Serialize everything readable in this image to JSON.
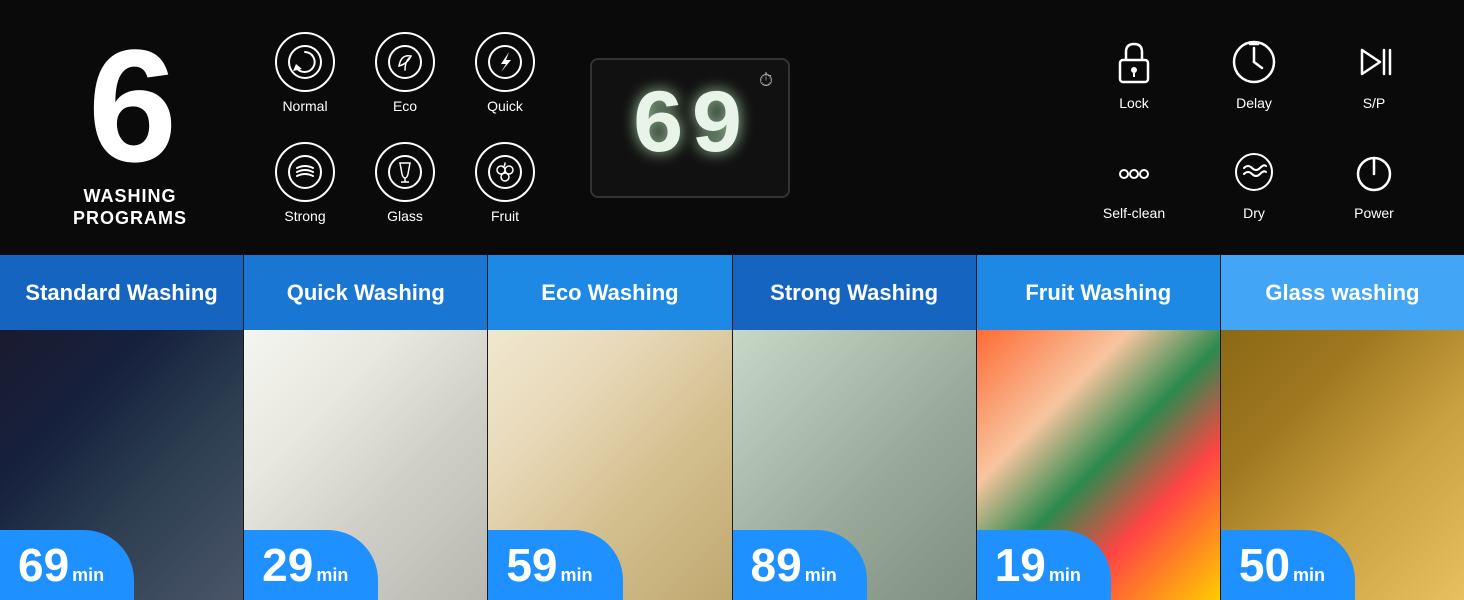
{
  "top": {
    "big_number": "6",
    "washing_programs_line1": "WASHING",
    "washing_programs_line2": "PROGRAMS",
    "display_number": "69",
    "programs": [
      {
        "id": "normal",
        "label": "Normal",
        "icon": "↻"
      },
      {
        "id": "eco",
        "label": "Eco",
        "icon": "♻"
      },
      {
        "id": "quick",
        "label": "Quick",
        "icon": "⚡"
      },
      {
        "id": "strong",
        "label": "Strong",
        "icon": "≋"
      },
      {
        "id": "glass",
        "label": "Glass",
        "icon": "🍷"
      },
      {
        "id": "fruit",
        "label": "Fruit",
        "icon": "🍇"
      }
    ],
    "controls": [
      {
        "id": "lock",
        "label": "Lock",
        "icon": "🔒"
      },
      {
        "id": "delay",
        "label": "Delay",
        "icon": "⏱"
      },
      {
        "id": "sp",
        "label": "S/P",
        "icon": "▷∥"
      },
      {
        "id": "selfclean",
        "label": "Self-clean",
        "icon": "···"
      },
      {
        "id": "dry",
        "label": "Dry",
        "icon": "≋"
      },
      {
        "id": "power",
        "label": "Power",
        "icon": "⏻"
      }
    ]
  },
  "wash_modes": [
    {
      "id": "standard",
      "label": "Standard Washing",
      "timer": "69",
      "unit": "min",
      "header_class": "blue1",
      "img_class": "img-standard"
    },
    {
      "id": "quick",
      "label": "Quick Washing",
      "timer": "29",
      "unit": "min",
      "header_class": "blue2",
      "img_class": "img-quick"
    },
    {
      "id": "eco",
      "label": "Eco Washing",
      "timer": "59",
      "unit": "min",
      "header_class": "blue3",
      "img_class": "img-eco"
    },
    {
      "id": "strong",
      "label": "Strong Washing",
      "timer": "89",
      "unit": "min",
      "header_class": "blue4",
      "img_class": "img-strong"
    },
    {
      "id": "fruit",
      "label": "Fruit Washing",
      "timer": "19",
      "unit": "min",
      "header_class": "blue5",
      "img_class": "img-fruit"
    },
    {
      "id": "glass",
      "label": "Glass washing",
      "timer": "50",
      "unit": "min",
      "header_class": "blue6",
      "img_class": "img-glass"
    }
  ]
}
